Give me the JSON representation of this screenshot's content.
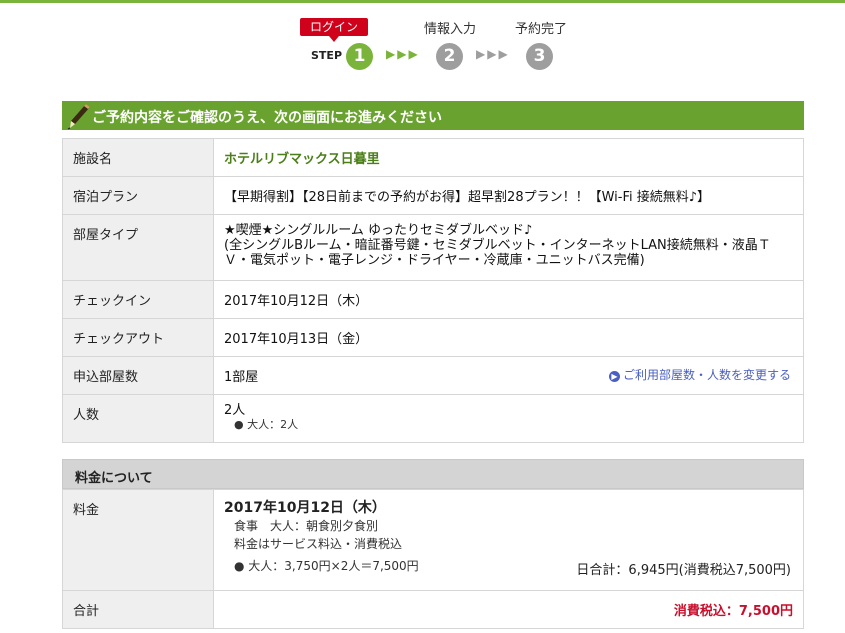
{
  "steps": {
    "badge": "ログイン",
    "step_word": "STEP",
    "items": [
      {
        "number": "1"
      },
      {
        "number": "2",
        "label": "情報入力"
      },
      {
        "number": "3",
        "label": "予約完了"
      }
    ],
    "arrows": "▶▶▶"
  },
  "confirm": {
    "header": "ご予約内容をご確認のうえ、次の画面にお進みください",
    "rows": {
      "facility_label": "施設名",
      "facility_value": "ホテルリブマックス日暮里",
      "plan_label": "宿泊プラン",
      "plan_value": "【早期得割】【28日前までの予約がお得】超早割28プラン！！【Wi-Fi 接続無料♪】",
      "room_label": "部屋タイプ",
      "room_value_1": "★喫煙★シングルルーム ゆったりセミダブルベッド♪",
      "room_value_2": "(全シングルBルーム・暗証番号鍵・セミダブルベット・インターネットLAN接続無料・液晶ＴＶ・電気ポット・電子レンジ・ドライヤー・冷蔵庫・ユニットバス完備)",
      "checkin_label": "チェックイン",
      "checkin_value": "2017年10月12日（木）",
      "checkout_label": "チェックアウト",
      "checkout_value": "2017年10月13日（金）",
      "rooms_label": "申込部屋数",
      "rooms_value": "1部屋",
      "change_link": "ご利用部屋数・人数を変更する",
      "guests_label": "人数",
      "guests_value": "2人",
      "guests_detail": "● 大人：2人"
    }
  },
  "fee": {
    "header": "料金について",
    "price_label": "料金",
    "date": "2017年10月12日（木）",
    "meal": "食事　大人：朝食別夕食別",
    "tax_note": "料金はサービス料込・消費税込",
    "breakdown": "● 大人：3,750円×2人＝7,500円",
    "daily_total": "日合計：6,945円(消費税込7,500円)",
    "total_label": "合計",
    "total_value": "消費税込：7,500円"
  },
  "colors": {
    "brand_green": "#6aa22f",
    "step_active": "#7bb43a",
    "step_inactive": "#9e9e9e",
    "alert_red": "#d0021b",
    "link_blue": "#4a5fc1"
  }
}
